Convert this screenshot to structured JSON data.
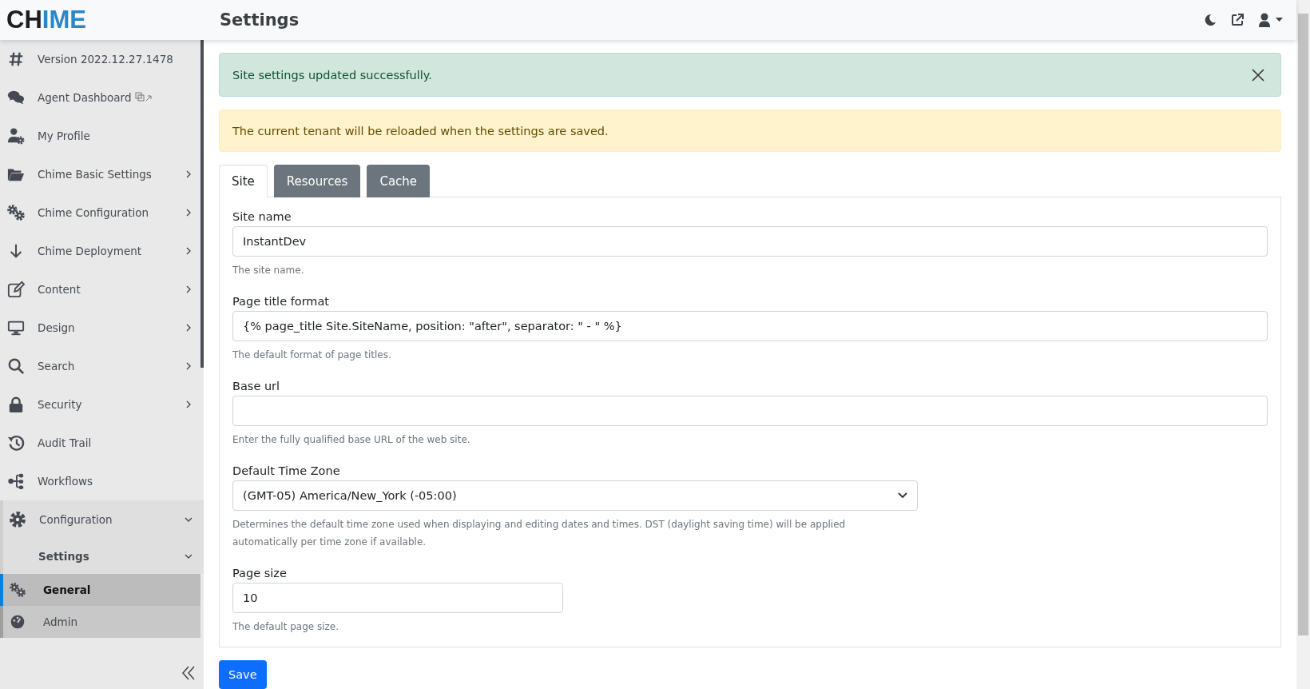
{
  "brand": {
    "prefix": "CH",
    "highlight": "IME"
  },
  "page_title": "Settings",
  "sidebar": {
    "items": [
      {
        "label": "Version 2022.12.27.1478"
      },
      {
        "label": "Agent Dashboard",
        "external": true
      },
      {
        "label": "My Profile"
      },
      {
        "label": "Chime Basic Settings",
        "expanded": false
      },
      {
        "label": "Chime Configuration",
        "expanded": false
      },
      {
        "label": "Chime Deployment",
        "expanded": false
      },
      {
        "label": "Content",
        "expanded": false
      },
      {
        "label": "Design",
        "expanded": false
      },
      {
        "label": "Search",
        "expanded": false
      },
      {
        "label": "Security",
        "expanded": false
      },
      {
        "label": "Audit Trail"
      },
      {
        "label": "Workflows"
      },
      {
        "label": "Configuration",
        "expanded": true,
        "children": [
          {
            "label": "Settings",
            "expanded": true,
            "children": [
              {
                "label": "General",
                "selected": true
              },
              {
                "label": "Admin",
                "selected": false
              }
            ]
          }
        ]
      }
    ]
  },
  "alerts": [
    {
      "kind": "success",
      "text": "Site settings updated successfully.",
      "dismissible": true
    },
    {
      "kind": "warning",
      "text": "The current tenant will be reloaded when the settings are saved.",
      "dismissible": false
    }
  ],
  "tabs": [
    {
      "label": "Site",
      "selected": true
    },
    {
      "label": "Resources",
      "selected": false
    },
    {
      "label": "Cache",
      "selected": false
    }
  ],
  "fields": [
    {
      "kind": "text",
      "label": "Site name",
      "value": "InstantDev",
      "help": "The site name."
    },
    {
      "kind": "text",
      "label": "Page title format",
      "value": "{% page_title Site.SiteName, position: \"after\", separator: \" - \" %}",
      "help": "The default format of page titles."
    },
    {
      "kind": "text",
      "label": "Base url",
      "help": "Enter the fully qualified base URL of the web site."
    },
    {
      "kind": "select",
      "label": "Default Time Zone",
      "value": "(GMT-05) America/New_York (-05:00)",
      "help": "Determines the default time zone used when displaying and editing dates and times. DST (daylight saving time) will be applied automatically per time zone if available."
    },
    {
      "kind": "number",
      "label": "Page size",
      "value": "10",
      "help": "The default page size."
    }
  ],
  "save_button": "Save"
}
